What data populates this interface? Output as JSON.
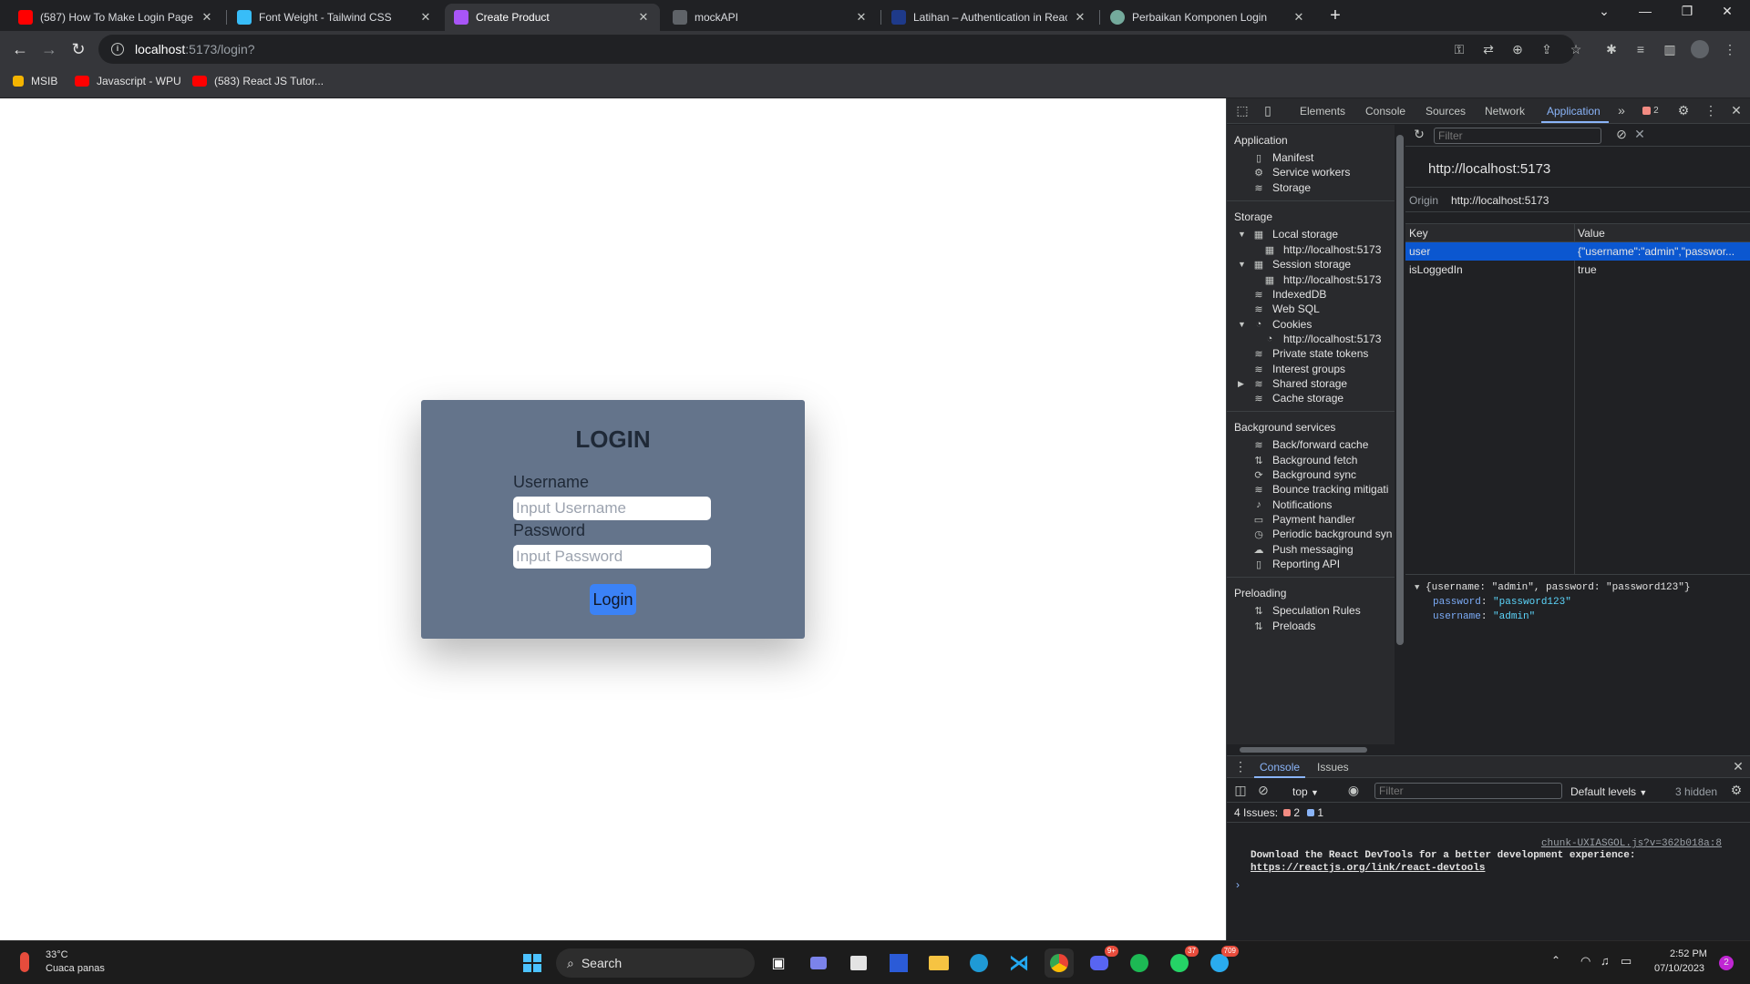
{
  "browser": {
    "tabs": [
      {
        "title": "(587) How To Make Login Page",
        "favicon_color": "#ff0000"
      },
      {
        "title": "Font Weight - Tailwind CSS",
        "favicon_color": "#38bdf8"
      },
      {
        "title": "Create Product",
        "favicon_color": "#a855f7"
      },
      {
        "title": "mockAPI",
        "favicon_color": "#5f6368"
      },
      {
        "title": "Latihan – Authentication in Reac",
        "favicon_color": "#1e3a8a"
      },
      {
        "title": "Perbaikan Komponen Login",
        "favicon_color": "#74aa9c"
      }
    ],
    "active_tab": 2,
    "url_host": "localhost",
    "url_path": ":5173/login?",
    "bookmarks": [
      {
        "label": "MSIB",
        "color": "#f4b400"
      },
      {
        "label": "Javascript - WPU",
        "color": "#ff0000"
      },
      {
        "label": "(583) React JS Tutor...",
        "color": "#ff0000"
      }
    ]
  },
  "login": {
    "title": "LOGIN",
    "username_label": "Username",
    "username_placeholder": "Input Username",
    "password_label": "Password",
    "password_placeholder": "Input Password",
    "button": "Login"
  },
  "devtools": {
    "tabs": [
      "Elements",
      "Console",
      "Sources",
      "Network",
      "Application"
    ],
    "active_tab": "Application",
    "error_count": "2",
    "sidebar": {
      "application_header": "Application",
      "application_items": [
        "Manifest",
        "Service workers",
        "Storage"
      ],
      "storage_header": "Storage",
      "local_storage": "Local storage",
      "local_storage_child": "http://localhost:5173",
      "session_storage": "Session storage",
      "session_storage_child": "http://localhost:5173",
      "indexeddb": "IndexedDB",
      "websql": "Web SQL",
      "cookies": "Cookies",
      "cookies_child": "http://localhost:5173",
      "private_state_tokens": "Private state tokens",
      "interest_groups": "Interest groups",
      "shared_storage": "Shared storage",
      "cache_storage": "Cache storage",
      "background_header": "Background services",
      "background_items": [
        "Back/forward cache",
        "Background fetch",
        "Background sync",
        "Bounce tracking mitigati",
        "Notifications",
        "Payment handler",
        "Periodic background syn",
        "Push messaging",
        "Reporting API"
      ],
      "preloading_header": "Preloading",
      "preloading_items": [
        "Speculation Rules",
        "Preloads"
      ]
    },
    "storage": {
      "filter_placeholder": "Filter",
      "origin_title": "http://localhost:5173",
      "origin_label": "Origin",
      "origin_value": "http://localhost:5173",
      "columns": [
        "Key",
        "Value"
      ],
      "rows": [
        {
          "key": "user",
          "value": "{\"username\":\"admin\",\"passwor..."
        },
        {
          "key": "isLoggedIn",
          "value": "true"
        }
      ],
      "preview_line": "{username: \"admin\", password: \"password123\"}",
      "preview_props": [
        {
          "key": "password",
          "value": "\"password123\""
        },
        {
          "key": "username",
          "value": "\"admin\""
        }
      ]
    },
    "drawer": {
      "tabs": [
        "Console",
        "Issues"
      ],
      "context": "top",
      "filter_placeholder": "Filter",
      "levels": "Default levels",
      "hidden": "3 hidden",
      "issues_label": "4 Issues:",
      "issues_errors": "2",
      "issues_info": "1",
      "message_source": "chunk-UXIASGOL.js?v=362b018a:8",
      "message_text": "Download the React DevTools for a better development experience: ",
      "message_link": "https://reactjs.org/link/react-devtools"
    }
  },
  "taskbar": {
    "weather_temp": "33°C",
    "weather_desc": "Cuaca panas",
    "search_label": "Search",
    "time": "2:52 PM",
    "date": "07/10/2023",
    "notification_count": "2",
    "badges": {
      "discord": "9+",
      "whatsapp": "37",
      "telegram": "709"
    }
  },
  "colors": {
    "card": "#64748b",
    "login_button": "#3b82f6",
    "devtools_bg": "#202124",
    "selected_row": "#0b57d0"
  }
}
